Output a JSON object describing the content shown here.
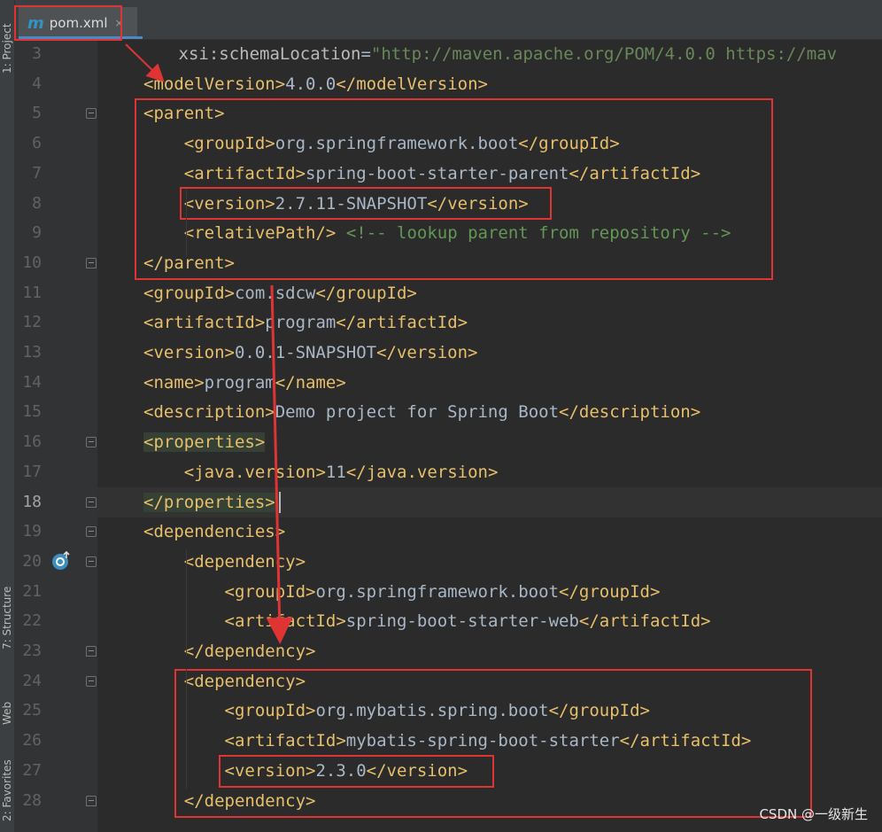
{
  "editor": {
    "tab": {
      "icon": "m",
      "filename": "pom.xml",
      "close": "×"
    },
    "current_line": 18,
    "lines": [
      {
        "n": "3",
        "segs": [
          [
            "attr",
            "        xsi"
          ],
          [
            "txt",
            ":"
          ],
          [
            "attr",
            "schemaLocation"
          ],
          [
            "txt",
            "="
          ],
          [
            "val",
            "\"http://maven.apache.org/POM/4.0.0 https://mav"
          ]
        ]
      },
      {
        "n": "4",
        "segs": [
          [
            "t",
            "<modelVersion>"
          ],
          [
            "txt",
            "4.0.0"
          ],
          [
            "t",
            "</modelVersion>"
          ]
        ]
      },
      {
        "n": "5",
        "segs": [
          [
            "t",
            "<parent>"
          ]
        ]
      },
      {
        "n": "6",
        "segs": [
          [
            "txt",
            "    "
          ],
          [
            "t",
            "<groupId>"
          ],
          [
            "txt",
            "org.springframework.boot"
          ],
          [
            "t",
            "</groupId>"
          ]
        ]
      },
      {
        "n": "7",
        "segs": [
          [
            "txt",
            "    "
          ],
          [
            "t",
            "<artifactId>"
          ],
          [
            "txt",
            "spring-boot-starter-parent"
          ],
          [
            "t",
            "</artifactId>"
          ]
        ]
      },
      {
        "n": "8",
        "segs": [
          [
            "txt",
            "    "
          ],
          [
            "t",
            "<version>"
          ],
          [
            "txt",
            "2.7.11-SNAPSHOT"
          ],
          [
            "t",
            "</version>"
          ]
        ]
      },
      {
        "n": "9",
        "segs": [
          [
            "txt",
            "    "
          ],
          [
            "t",
            "<relativePath/>"
          ],
          [
            "txt",
            " "
          ],
          [
            "com",
            "<!-- lookup parent from repository -->"
          ]
        ]
      },
      {
        "n": "10",
        "segs": [
          [
            "t",
            "</parent>"
          ]
        ]
      },
      {
        "n": "11",
        "segs": [
          [
            "t",
            "<groupId>"
          ],
          [
            "txt",
            "com.sdcw"
          ],
          [
            "t",
            "</groupId>"
          ]
        ]
      },
      {
        "n": "12",
        "segs": [
          [
            "t",
            "<artifactId>"
          ],
          [
            "txt",
            "program"
          ],
          [
            "t",
            "</artifactId>"
          ]
        ]
      },
      {
        "n": "13",
        "segs": [
          [
            "t",
            "<version>"
          ],
          [
            "txt",
            "0.0.1-SNAPSHOT"
          ],
          [
            "t",
            "</version>"
          ]
        ]
      },
      {
        "n": "14",
        "segs": [
          [
            "t",
            "<name>"
          ],
          [
            "txt",
            "program"
          ],
          [
            "t",
            "</name>"
          ]
        ]
      },
      {
        "n": "15",
        "segs": [
          [
            "t",
            "<description>"
          ],
          [
            "txt",
            "Demo project for Spring Boot"
          ],
          [
            "t",
            "</description>"
          ]
        ]
      },
      {
        "n": "16",
        "segs": [
          [
            "t hl",
            "<properties>"
          ]
        ]
      },
      {
        "n": "17",
        "segs": [
          [
            "txt",
            "    "
          ],
          [
            "t",
            "<java.version>"
          ],
          [
            "txt",
            "11"
          ],
          [
            "t",
            "</java.version>"
          ]
        ]
      },
      {
        "n": "18",
        "segs": [
          [
            "t hl",
            "</properties>"
          ]
        ]
      },
      {
        "n": "19",
        "segs": [
          [
            "t",
            "<dependencies>"
          ]
        ]
      },
      {
        "n": "20",
        "segs": [
          [
            "txt",
            "    "
          ],
          [
            "t",
            "<dependency>"
          ]
        ]
      },
      {
        "n": "21",
        "segs": [
          [
            "txt",
            "        "
          ],
          [
            "t",
            "<groupId>"
          ],
          [
            "txt",
            "org.springframework.boot"
          ],
          [
            "t",
            "</groupId>"
          ]
        ]
      },
      {
        "n": "22",
        "segs": [
          [
            "txt",
            "        "
          ],
          [
            "t",
            "<artifactId>"
          ],
          [
            "txt",
            "spring-boot-starter-web"
          ],
          [
            "t",
            "</artifactId>"
          ]
        ]
      },
      {
        "n": "23",
        "segs": [
          [
            "txt",
            "    "
          ],
          [
            "t",
            "</dependency>"
          ]
        ]
      },
      {
        "n": "24",
        "segs": [
          [
            "txt",
            "    "
          ],
          [
            "t",
            "<dependency>"
          ]
        ]
      },
      {
        "n": "25",
        "segs": [
          [
            "txt",
            "        "
          ],
          [
            "t",
            "<groupId>"
          ],
          [
            "txt",
            "org.mybatis.spring.boot"
          ],
          [
            "t",
            "</groupId>"
          ]
        ]
      },
      {
        "n": "26",
        "segs": [
          [
            "txt",
            "        "
          ],
          [
            "t",
            "<artifactId>"
          ],
          [
            "txt",
            "mybatis-spring-boot-starter"
          ],
          [
            "t",
            "</artifactId>"
          ]
        ]
      },
      {
        "n": "27",
        "segs": [
          [
            "txt",
            "        "
          ],
          [
            "t",
            "<version>"
          ],
          [
            "txt",
            "2.3.0"
          ],
          [
            "t",
            "</version>"
          ]
        ]
      },
      {
        "n": "28",
        "segs": [
          [
            "txt",
            "    "
          ],
          [
            "t",
            "</dependency>"
          ]
        ]
      }
    ]
  },
  "side_tabs": {
    "project": "1: Project",
    "structure": "7: Structure",
    "web": "Web",
    "favorites": "2: Favorites"
  },
  "watermark": "CSDN @一级新生",
  "colors": {
    "tag": "#e8bf6a",
    "text": "#a9b7c6",
    "comment": "#629755",
    "string": "#6a8759",
    "annotation": "#e03434"
  }
}
